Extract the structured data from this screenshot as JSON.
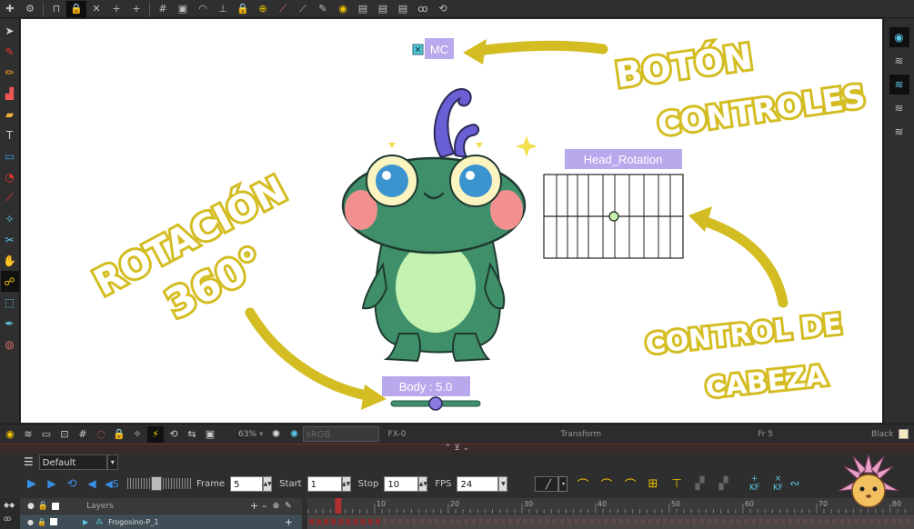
{
  "colors": {
    "annotation": "#d4bd22",
    "label_bg": "#b9a9ec",
    "frog_body": "#3f8f6a",
    "frog_belly": "#c4f2b0",
    "frog_crest": "#6b5fd6",
    "accent_blue": "#5ac8e8",
    "timeline_red": "#b03030"
  },
  "toolbar": {
    "icons": [
      "plus-icon",
      "gear-icon",
      "camera-reset-icon",
      "lock-icon",
      "x-icon",
      "plus-small-icon",
      "plus-small-icon",
      "grid-icon",
      "camera-icon",
      "onion-skin-icon",
      "weight-icon",
      "lock-icon",
      "add-icon",
      "cut-icon",
      "tilde-icon",
      "pencil-icon",
      "bulb-icon",
      "table-icon",
      "table-icon",
      "loop-icon",
      "loop-icon"
    ]
  },
  "canvas": {
    "mc_label": "MC",
    "head_label": "Head_Rotation",
    "body_label": "Body : 5.0",
    "annotation_button_controls_1": "BOTÓN",
    "annotation_button_controls_2": "CONTROLES",
    "annotation_rotation_1": "ROTACIÓN",
    "annotation_rotation_2": "360°",
    "annotation_head_1": "CONTROL DE",
    "annotation_head_2": "CABEZA",
    "slider_value": 0.5
  },
  "cam_bar": {
    "zoom": "63%",
    "color_space": "sRGB",
    "fx": "FX-0",
    "mode": "Transform",
    "frame": "Fr 5",
    "bg_color_name": "Black"
  },
  "timeline": {
    "display_select": "Default (Display)",
    "frame_label": "Frame",
    "frame_value": "5",
    "start_label": "Start",
    "start_value": "1",
    "stop_label": "Stop",
    "stop_value": "10",
    "fps_label": "FPS",
    "fps_value": "24",
    "kf_label": "KF",
    "layers_label": "Layers",
    "layer_name": "Frogosino-P_1",
    "ruler_ticks": [
      "10",
      "20",
      "30",
      "40",
      "50",
      "60",
      "70",
      "80"
    ]
  }
}
